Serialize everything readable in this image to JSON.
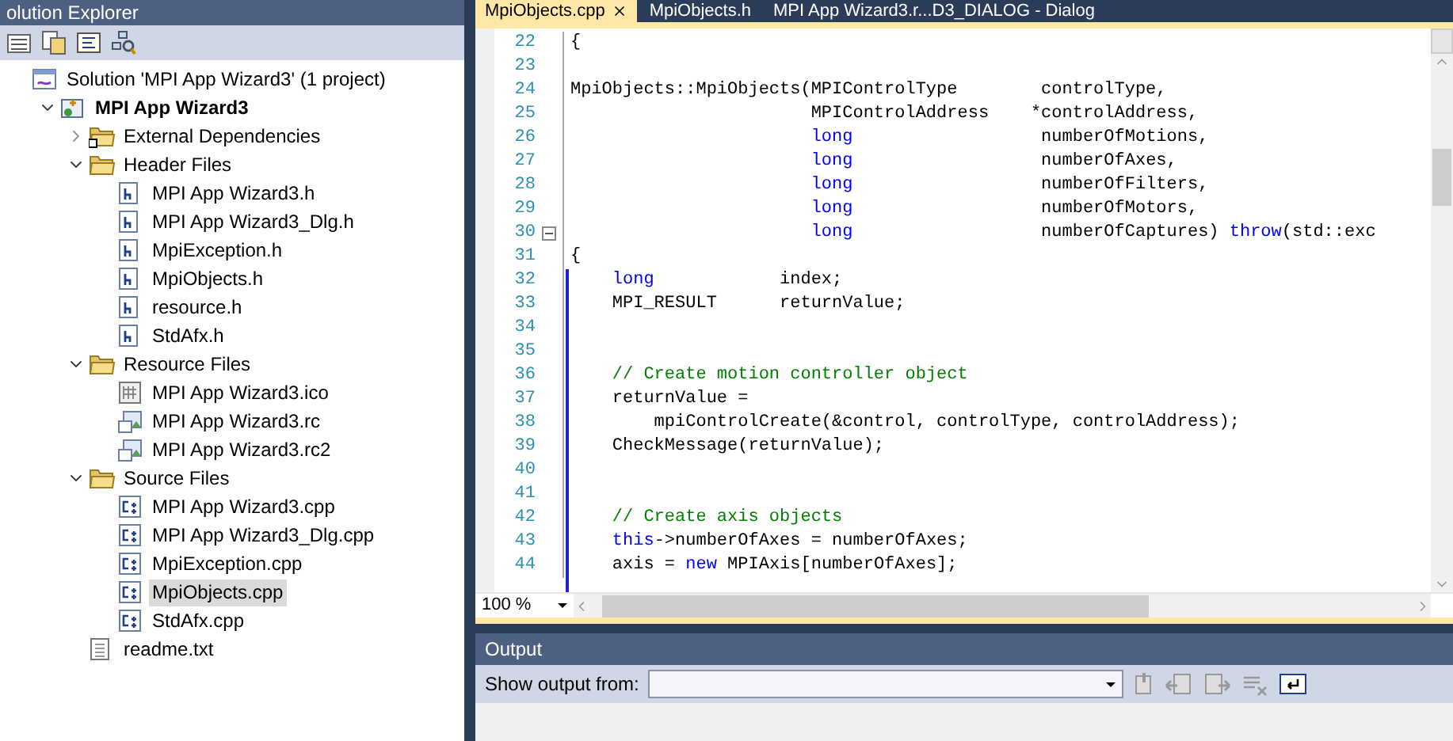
{
  "solution_explorer": {
    "title": "olution Explorer",
    "tree": [
      {
        "label": "Solution 'MPI App Wizard3' (1 project)",
        "kind": "solution",
        "selected": false,
        "children": [
          {
            "label": "MPI App Wizard3",
            "kind": "project",
            "expanded": true,
            "selected": false,
            "children": [
              {
                "label": "External Dependencies",
                "kind": "deps",
                "expanded": false,
                "selected": false
              },
              {
                "label": "Header Files",
                "kind": "folder",
                "expanded": true,
                "selected": false,
                "children": [
                  {
                    "label": "MPI App Wizard3.h",
                    "kind": "h",
                    "selected": false
                  },
                  {
                    "label": "MPI App Wizard3_Dlg.h",
                    "kind": "h",
                    "selected": false
                  },
                  {
                    "label": "MpiException.h",
                    "kind": "h",
                    "selected": false
                  },
                  {
                    "label": "MpiObjects.h",
                    "kind": "h",
                    "selected": false
                  },
                  {
                    "label": "resource.h",
                    "kind": "h",
                    "selected": false
                  },
                  {
                    "label": "StdAfx.h",
                    "kind": "h",
                    "selected": false
                  }
                ]
              },
              {
                "label": "Resource Files",
                "kind": "folder",
                "expanded": true,
                "selected": false,
                "children": [
                  {
                    "label": "MPI App Wizard3.ico",
                    "kind": "ico",
                    "selected": false
                  },
                  {
                    "label": "MPI App Wizard3.rc",
                    "kind": "rc",
                    "selected": false
                  },
                  {
                    "label": "MPI App Wizard3.rc2",
                    "kind": "rc",
                    "selected": false
                  }
                ]
              },
              {
                "label": "Source Files",
                "kind": "folder",
                "expanded": true,
                "selected": false,
                "children": [
                  {
                    "label": "MPI App Wizard3.cpp",
                    "kind": "cpp",
                    "selected": false
                  },
                  {
                    "label": "MPI App Wizard3_Dlg.cpp",
                    "kind": "cpp",
                    "selected": false
                  },
                  {
                    "label": "MpiException.cpp",
                    "kind": "cpp",
                    "selected": false
                  },
                  {
                    "label": "MpiObjects.cpp",
                    "kind": "cpp",
                    "selected": true
                  },
                  {
                    "label": "StdAfx.cpp",
                    "kind": "cpp",
                    "selected": false
                  }
                ]
              },
              {
                "label": "readme.txt",
                "kind": "txt",
                "selected": false
              }
            ]
          }
        ]
      }
    ]
  },
  "editor": {
    "tabs": [
      {
        "label": "MpiObjects.cpp",
        "selected": true
      },
      {
        "label": "MpiObjects.h",
        "selected": false
      },
      {
        "label": "MPI App Wizard3.r...D3_DIALOG - Dialog",
        "selected": false
      }
    ],
    "lines": [
      {
        "number": "22",
        "fold": false,
        "tokens": [
          {
            "kind": "plain",
            "text": "{"
          }
        ]
      },
      {
        "number": "23",
        "fold": false
      },
      {
        "number": "24",
        "fold": false,
        "tokens": [
          {
            "kind": "plain",
            "text": "MpiObjects::MpiObjects(MPIControlType        controlType,"
          }
        ]
      },
      {
        "number": "25",
        "fold": false,
        "tokens": [
          {
            "kind": "plain",
            "text": "                       MPIControlAddress    *controlAddress,"
          }
        ]
      },
      {
        "number": "26",
        "fold": false,
        "tokens": [
          {
            "kind": "keyword",
            "text": "                       long"
          },
          {
            "kind": "plain",
            "text": "                  numberOfMotions,"
          }
        ]
      },
      {
        "number": "27",
        "fold": false,
        "tokens": [
          {
            "kind": "keyword",
            "text": "                       long"
          },
          {
            "kind": "plain",
            "text": "                  numberOfAxes,"
          }
        ]
      },
      {
        "number": "28",
        "fold": false,
        "tokens": [
          {
            "kind": "keyword",
            "text": "                       long"
          },
          {
            "kind": "plain",
            "text": "                  numberOfFilters,"
          }
        ]
      },
      {
        "number": "29",
        "fold": false,
        "tokens": [
          {
            "kind": "keyword",
            "text": "                       long"
          },
          {
            "kind": "plain",
            "text": "                  numberOfMotors,"
          }
        ]
      },
      {
        "number": "30",
        "fold": true,
        "tokens": [
          {
            "kind": "keyword",
            "text": "                       long"
          },
          {
            "kind": "plain",
            "text": "                  numberOfCaptures) "
          },
          {
            "kind": "keyword",
            "text": "throw"
          },
          {
            "kind": "plain",
            "text": "(std::exc"
          }
        ]
      },
      {
        "number": "31",
        "fold": false,
        "tokens": [
          {
            "kind": "plain",
            "text": "{"
          }
        ]
      },
      {
        "number": "32",
        "fold": false,
        "tokens": [
          {
            "kind": "keyword",
            "text": "    long"
          },
          {
            "kind": "plain",
            "text": "            index;"
          }
        ]
      },
      {
        "number": "33",
        "fold": false,
        "tokens": [
          {
            "kind": "plain",
            "text": "    MPI_RESULT      returnValue;"
          }
        ]
      },
      {
        "number": "34",
        "fold": false
      },
      {
        "number": "35",
        "fold": false
      },
      {
        "number": "36",
        "fold": false,
        "tokens": [
          {
            "kind": "comment",
            "text": "    // Create motion controller object"
          }
        ]
      },
      {
        "number": "37",
        "fold": false,
        "tokens": [
          {
            "kind": "plain",
            "text": "    returnValue ="
          }
        ]
      },
      {
        "number": "38",
        "fold": false,
        "tokens": [
          {
            "kind": "plain",
            "text": "        mpiControlCreate(&control, controlType, controlAddress);"
          }
        ]
      },
      {
        "number": "39",
        "fold": false,
        "tokens": [
          {
            "kind": "plain",
            "text": "    CheckMessage(returnValue);"
          }
        ]
      },
      {
        "number": "40",
        "fold": false
      },
      {
        "number": "41",
        "fold": false
      },
      {
        "number": "42",
        "fold": false,
        "tokens": [
          {
            "kind": "comment",
            "text": "    // Create axis objects"
          }
        ]
      },
      {
        "number": "43",
        "fold": false,
        "tokens": [
          {
            "kind": "keyword",
            "text": "    this"
          },
          {
            "kind": "plain",
            "text": "->numberOfAxes = numberOfAxes;"
          }
        ]
      },
      {
        "number": "44",
        "fold": false,
        "tokens": [
          {
            "kind": "plain",
            "text": "    axis = "
          },
          {
            "kind": "keyword",
            "text": "new"
          },
          {
            "kind": "plain",
            "text": " MPIAxis[numberOfAxes];"
          }
        ]
      }
    ],
    "zoom": "100 %"
  },
  "output": {
    "title": "Output",
    "show_output_from_label": "Show output from:"
  }
}
